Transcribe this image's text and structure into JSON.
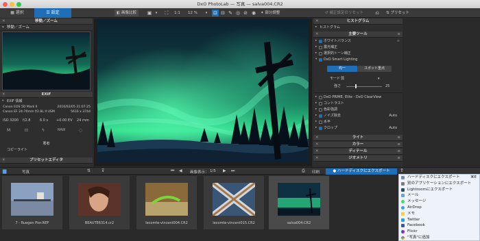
{
  "window": {
    "title": "DxO PhotoLab — 写真 — salva004.CR2"
  },
  "toolbar": {
    "tab_select": "選択",
    "tab_customize": "設定",
    "compare": "画像比較",
    "zoom_ratio": "1:1",
    "zoom_percent": "12 %",
    "partial_adjust": "部分調整",
    "reset_corrections": "補正設定のリセット",
    "preset": "プリセット"
  },
  "left_panel": {
    "move_zoom_title": "移動／ズーム",
    "exif_title": "EXIF",
    "exif_info_label": "EXIF 情報",
    "camera": "Canon EOS 5D Mark II",
    "date": "2016/02/05 21:07:25",
    "lens": "Canon EF 24-70mm f/2.8L II USM",
    "dimensions": "5616 x 3744",
    "iso": "ISO 3200",
    "aperture": "f/2.8",
    "shutter": "6.0 s",
    "ev": "+0.00 EV",
    "focal": "24 mm",
    "mode_m": "M",
    "raw": "RAW",
    "author_label": "著者",
    "copyright_label": "コピーライト",
    "preset_editor": "プリセットエディタ"
  },
  "right_panel": {
    "histogram_title": "ヒストグラム",
    "histogram_sub": "ヒストグラム",
    "main_tools_title": "主要ツール",
    "tools": [
      {
        "label": "ホワイトバランス",
        "value": ""
      },
      {
        "label": "露光補正",
        "value": ""
      },
      {
        "label": "選択的トーン補正",
        "value": ""
      },
      {
        "label": "DxO Smart Lighting",
        "value": ""
      }
    ],
    "smart_lighting": {
      "uniform": "均一",
      "spot": "スポット重点",
      "mode_label": "モード",
      "mode_value": "弱",
      "strength_label": "強さ",
      "strength_value": "25",
      "strength_level": 0.25
    },
    "tools2": [
      {
        "label": "DxO PRIME, Elite - DxO ClearView",
        "value": ""
      },
      {
        "label": "コントラスト",
        "value": ""
      },
      {
        "label": "色彩強調",
        "value": ""
      },
      {
        "label": "ノイズ除去",
        "value": "Auto"
      },
      {
        "label": "水平",
        "value": ""
      },
      {
        "label": "クロップ",
        "value": "Auto"
      }
    ],
    "sections": [
      "ライト",
      "カラー",
      "ディテール",
      "ジオメトリ"
    ]
  },
  "filmstrip_bar": {
    "folder_label": "写真",
    "image_count_label": "画像表示：",
    "image_count": "1/5",
    "print": "印刷",
    "export": "ハードディスクにエクスポート"
  },
  "thumbnails": [
    {
      "name": "7 - Ruegen Pier.NEF"
    },
    {
      "name": "BEAUTE6314.cr2"
    },
    {
      "name": "lecomte-vincent004.CR2"
    },
    {
      "name": "lecomte-vincent015.CR2"
    },
    {
      "name": "salva004.CR2"
    }
  ],
  "share_menu": {
    "items": [
      "ハードディスクにエクスポート",
      "別のアプリケーションにエクスポート",
      "Lightroomにエクスポート",
      "メール",
      "メッセージ",
      "AirDrop",
      "メモ",
      "Twitter",
      "Facebook",
      "Flickr",
      "\"写真\"に追加"
    ],
    "shortcut": "⌘E"
  },
  "colors": {
    "accent": "#1f6fb8",
    "aurora": "#2ed98a",
    "sky": "#0c2a3a"
  }
}
